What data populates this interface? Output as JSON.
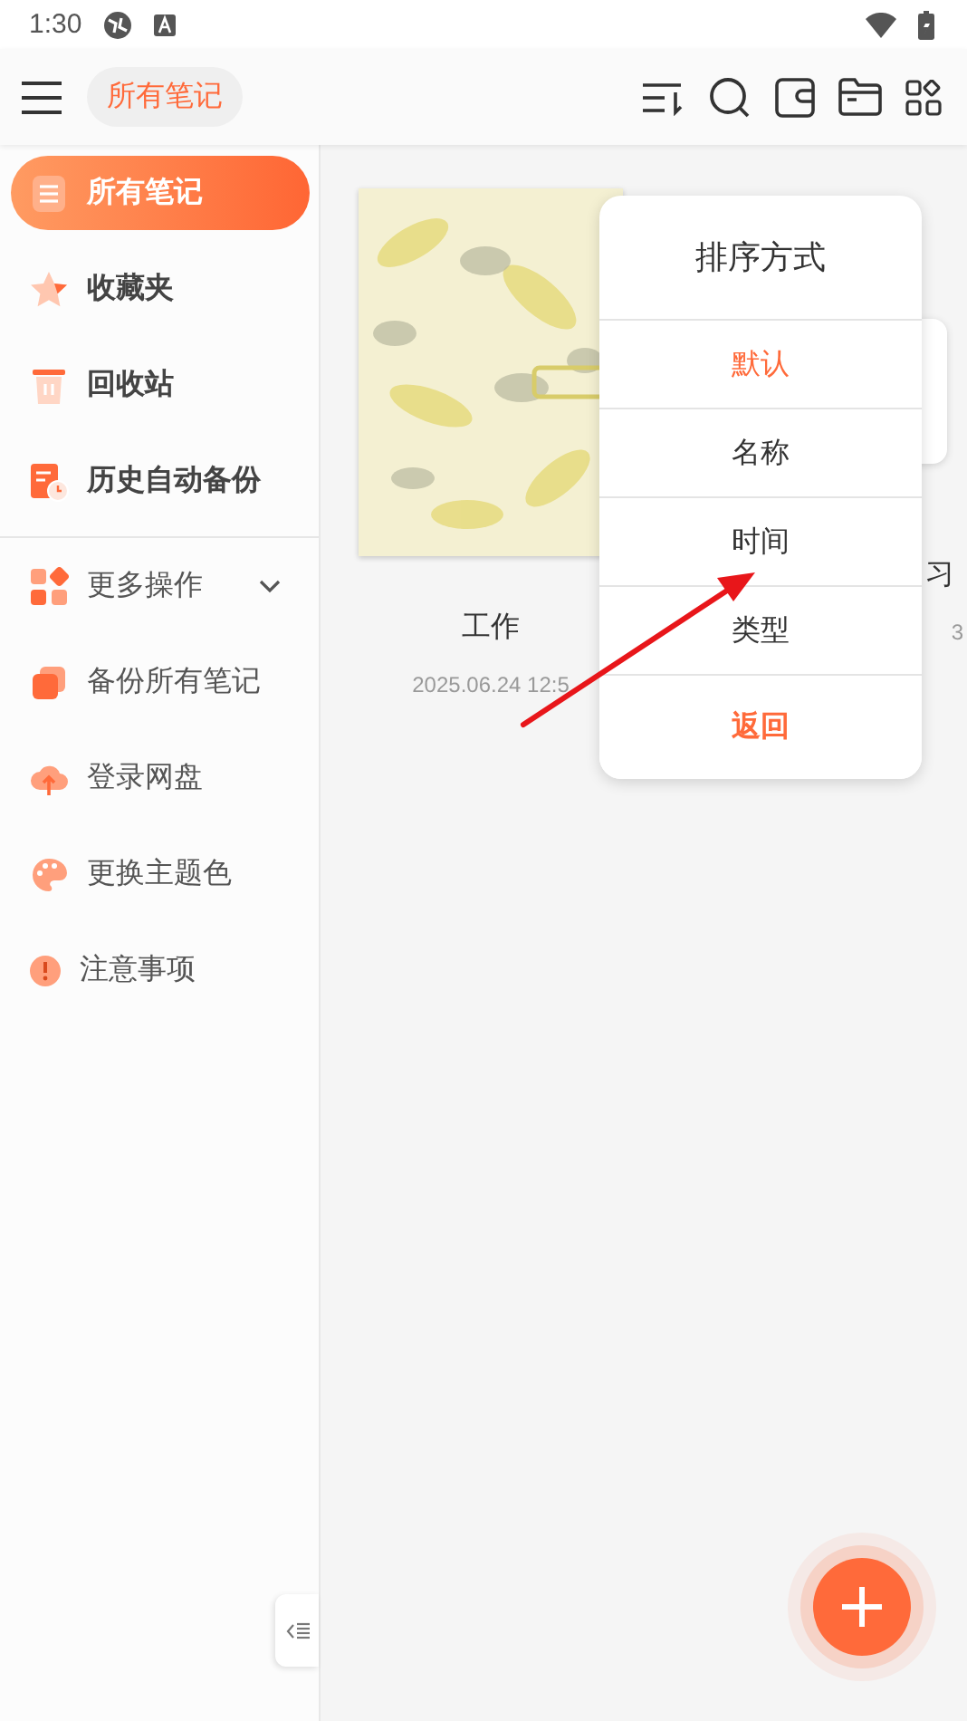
{
  "status_bar": {
    "time": "1:30"
  },
  "toolbar": {
    "title_chip": "所有笔记"
  },
  "sidebar": {
    "primary": [
      {
        "label": "所有笔记",
        "selected": true
      },
      {
        "label": "收藏夹",
        "selected": false
      },
      {
        "label": "回收站",
        "selected": false
      },
      {
        "label": "历史自动备份",
        "selected": false
      }
    ],
    "secondary": [
      {
        "label": "更多操作",
        "kind": "expander",
        "expanded": false
      },
      {
        "label": "备份所有笔记",
        "kind": "link"
      },
      {
        "label": "登录网盘",
        "kind": "link"
      },
      {
        "label": "更换主题色",
        "kind": "link"
      },
      {
        "label": "注意事项",
        "kind": "link"
      }
    ]
  },
  "notes": [
    {
      "title": "工作",
      "date": "2025.06.24 12:5"
    },
    {
      "title": "习",
      "date": "3"
    }
  ],
  "sort_menu": {
    "title": "排序方式",
    "items": [
      {
        "label": "默认",
        "kind": "option",
        "selected": true
      },
      {
        "label": "名称",
        "kind": "option",
        "selected": false
      },
      {
        "label": "时间",
        "kind": "option",
        "selected": false
      },
      {
        "label": "类型",
        "kind": "option",
        "selected": false
      },
      {
        "label": "返回",
        "kind": "back"
      }
    ]
  }
}
